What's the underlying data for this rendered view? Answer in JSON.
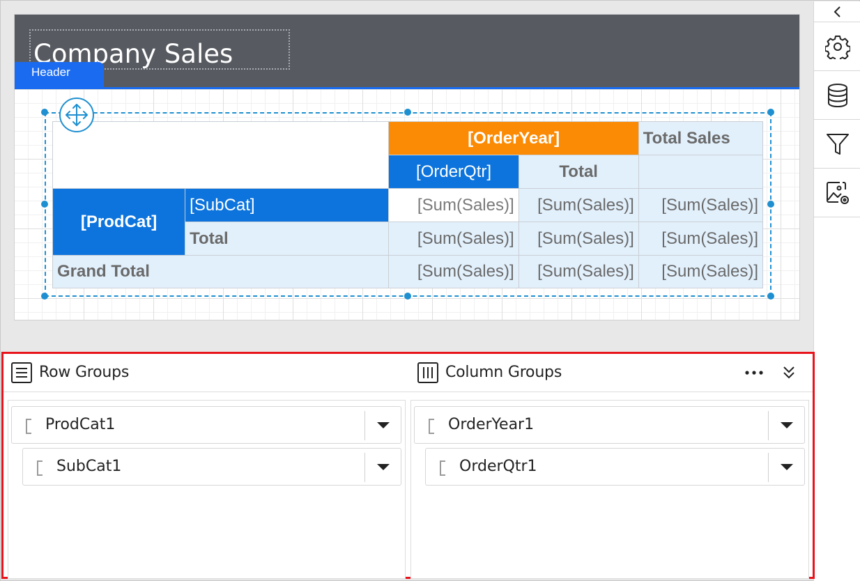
{
  "report": {
    "title": "Company Sales",
    "header_tag": "Header"
  },
  "tablix": {
    "order_year": "[OrderYear]",
    "total_sales": "Total Sales",
    "order_qtr": "[OrderQtr]",
    "total_col": "Total",
    "prod_cat": "[ProdCat]",
    "sub_cat": "[SubCat]",
    "row_total": "Total",
    "grand_total": "Grand Total",
    "sum_sales": "[Sum(Sales)]"
  },
  "toolbar": {
    "icons": [
      "chevron-left-icon",
      "gear-icon",
      "database-icon",
      "filter-icon",
      "image-settings-icon"
    ]
  },
  "grouping": {
    "row_groups_label": "Row Groups",
    "column_groups_label": "Column Groups",
    "row_groups": [
      "ProdCat1",
      "SubCat1"
    ],
    "column_groups": [
      "OrderYear1",
      "OrderQtr1"
    ]
  },
  "colors": {
    "header_bg": "#575b61",
    "accent_blue": "#1a6bf0",
    "cell_orange": "#fb8a04",
    "cell_blue": "#0c74dc",
    "cell_light": "#e2f0fc",
    "selection": "#1e8fd0",
    "highlight_border": "#e8141c"
  }
}
